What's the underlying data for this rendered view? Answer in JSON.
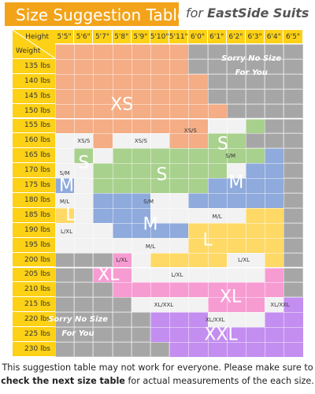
{
  "title": {
    "main_a": "Size Suggestion",
    "main_b": "Table",
    "for": "for",
    "brand": "EastSide Suits"
  },
  "corner": {
    "height": "Height",
    "weight": "Weight"
  },
  "heights": [
    "5'5\"",
    "5'6\"",
    "5'7\"",
    "5'8\"",
    "5'9\"",
    "5'10\"",
    "5'11\"",
    "6'0\"",
    "6'1\"",
    "6'2\"",
    "6'3\"",
    "6'4\"",
    "6'5\""
  ],
  "weights": [
    "130 lbs",
    "135 lbs",
    "140 lbs",
    "145 lbs",
    "150 lbs",
    "155 lbs",
    "160 lbs",
    "165 lbs",
    "170 lbs",
    "175 lbs",
    "180 lbs",
    "185 lbs",
    "190 lbs",
    "195 lbs",
    "200 lbs",
    "205 lbs",
    "210 lbs",
    "215 lbs",
    "220 lbs",
    "225 lbs",
    "230 lbs"
  ],
  "labels": {
    "xs": "XS",
    "s": "S",
    "m": "M",
    "l": "L",
    "xl": "XL",
    "xxl": "XXL",
    "xs_s": "XS/S",
    "s_m": "S/M",
    "m_l": "M/L",
    "l_xl": "L/XL",
    "xl_xxl": "XL/XXL",
    "sorry1": "Sorry No Size",
    "sorry2": "For You"
  },
  "note": {
    "line1": "This suggestion table may not work for everyone. Please make sure to",
    "bold": "check the next size table",
    "line2_rest": " for actual measurements of the each size."
  },
  "colors": {
    "header": "#fcd116",
    "grey": "#a6a6a6",
    "xs": "#f4ad85",
    "s": "#a9d18e",
    "m": "#8faadc",
    "l": "#ffd966",
    "xl": "#f79cd3",
    "xxl": "#c38ef0",
    "between": "#f2f2f2"
  }
}
